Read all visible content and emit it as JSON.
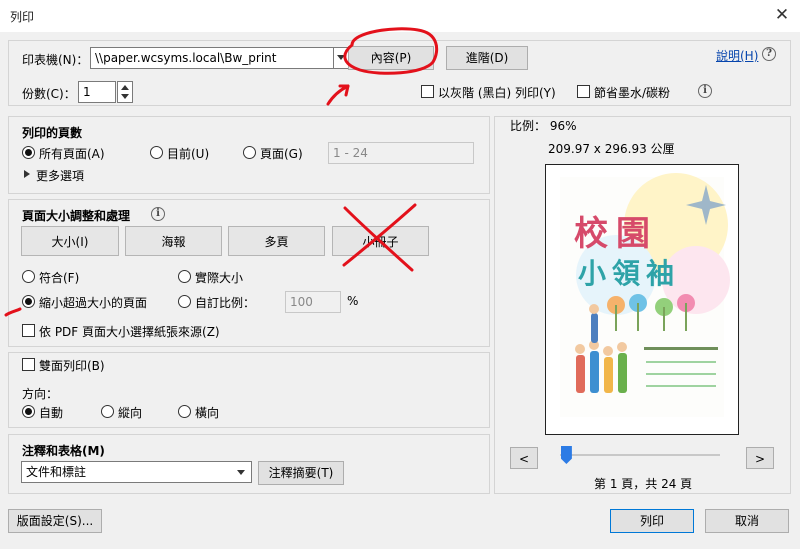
{
  "window": {
    "title": "列印"
  },
  "printer": {
    "label": "印表機(N)：",
    "value": "\\\\paper.wcsyms.local\\Bw_print",
    "properties_label": "內容(P)",
    "advanced_label": "進階(D)",
    "help_label": "說明(H)"
  },
  "copies": {
    "label": "份數(C)：",
    "value": "1"
  },
  "options": {
    "grayscale_label": "以灰階 (黑白) 列印(Y)",
    "save_ink_label": "節省墨水/碳粉"
  },
  "pages_to_print": {
    "title": "列印的頁數",
    "all_label": "所有頁面(A)",
    "current_label": "目前(U)",
    "pages_label": "頁面(G)",
    "range_value": "1 - 24",
    "more_options_label": "更多選項"
  },
  "page_sizing": {
    "title": "頁面大小調整和處理",
    "size_label": "大小(I)",
    "poster_label": "海報",
    "multiple_label": "多頁",
    "booklet_label": "小冊子",
    "fit_label": "符合(F)",
    "actual_size_label": "實際大小",
    "shrink_label": "縮小超過大小的頁面",
    "custom_scale_label": "自訂比例：",
    "scale_value": "100",
    "percent": "%",
    "paper_source_label": "依 PDF 頁面大小選擇紙張來源(Z)"
  },
  "duplex": {
    "label": "雙面列印(B)"
  },
  "orientation": {
    "label": "方向：",
    "auto_label": "自動",
    "portrait_label": "縱向",
    "landscape_label": "橫向"
  },
  "comments": {
    "title": "注釋和表格(M)",
    "select_value": "文件和標註",
    "summary_label": "注釋摘要(T)"
  },
  "preview": {
    "scale_text": "比例： 96%",
    "size_text": "209.97 x 296.93 公厘",
    "page_status": "第 1 頁，共 24 頁",
    "prev_label": "<",
    "next_label": ">",
    "slider_fraction": 0.04,
    "poster_title_row1": "校園",
    "poster_title_row2": "小領袖"
  },
  "footer": {
    "page_setup_label": "版面設定(S)...",
    "print_label": "列印",
    "cancel_label": "取消"
  }
}
